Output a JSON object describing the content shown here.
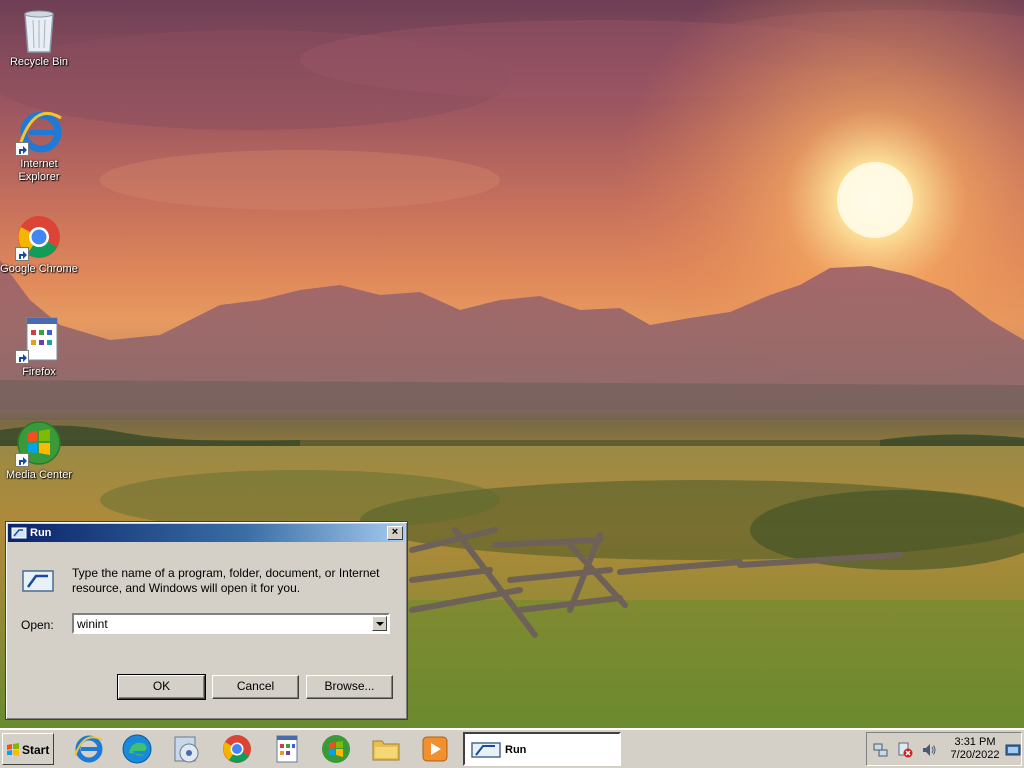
{
  "desktop": {
    "icons": [
      {
        "label": "Recycle Bin",
        "icon": "recycle-bin-icon"
      },
      {
        "label": "Internet Explorer",
        "icon": "internet-explorer-icon"
      },
      {
        "label": "Google Chrome",
        "icon": "chrome-icon"
      },
      {
        "label": "Firefox",
        "icon": "firefox-shortcut-icon"
      },
      {
        "label": "Media Center",
        "icon": "windows-logo-icon"
      }
    ]
  },
  "run_dialog": {
    "title": "Run",
    "close_label": "×",
    "description": "Type the name of a program, folder, document, or Internet resource, and Windows will open it for you.",
    "open_label": "Open:",
    "open_value": "winint",
    "ok_label": "OK",
    "cancel_label": "Cancel",
    "browse_label": "Browse..."
  },
  "taskbar": {
    "start_label": "Start",
    "quick_launch": [
      "internet-explorer-icon",
      "edge-icon",
      "media-player-icon",
      "chrome-icon",
      "document-icon",
      "windows-logo-icon",
      "folder-icon",
      "play-icon"
    ],
    "active_task": "Run",
    "tray": {
      "time": "3:31 PM",
      "date": "7/20/2022"
    }
  },
  "colors": {
    "titlebar_start": "#0a246a",
    "titlebar_end": "#a6caf0",
    "dialog_face": "#d4d0c8"
  }
}
